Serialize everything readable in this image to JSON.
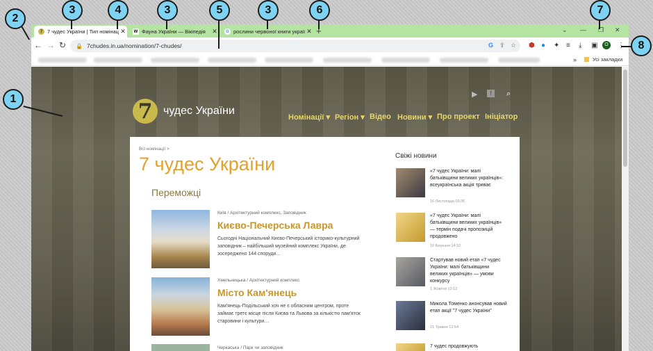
{
  "browser": {
    "tabs": [
      {
        "title": "7 чудес України | Тип номінації",
        "favicon": "7"
      },
      {
        "title": "Фауна України — Вікіпедія",
        "favicon": "W"
      },
      {
        "title": "рослини червоної книги україн",
        "favicon": "G"
      }
    ],
    "new_tab": "+",
    "url": "7chudes.in.ua/nomination/7-chudes/",
    "all_bookmarks": "Усі закладки",
    "more_bookmarks": "»",
    "profile_initial": "O"
  },
  "site": {
    "logo_num": "7",
    "logo_text": "чудес України",
    "menu": [
      "Номінації ▾",
      "Регіон ▾",
      "Відео",
      "Новини ▾",
      "Про проект",
      "Ініціатор"
    ],
    "breadcrumb": "Всі номінації >",
    "page_title": "7 чудес України",
    "section_title": "Переможці",
    "items": [
      {
        "category": "Київ / Архітектурний комплекс, Заповідник",
        "title": "Києво-Печерська Лавра",
        "desc": "Сьогодні Національний Києво-Печерський історико-культурний заповідник – найбільший музейний комплекс України, де зосереджено 144 споруди…"
      },
      {
        "category": "Хмельницька / Архітектурний комплекс",
        "title": "Місто Кам'янець",
        "desc": "Кам'янець-Подільський хоч не є обласним центром, проте займає третє місце після Києва та Львова за кількістю пам'яток старовини і культури…"
      },
      {
        "category": "Черкаська / Парк чи заповідник",
        "title": "",
        "desc": ""
      }
    ],
    "news_heading": "Свіжі новини",
    "news": [
      {
        "title": "«7 чудес України: малі батьківщини великих українців»: всеукраїнська акція триває",
        "date": "16 Листопада 09:36"
      },
      {
        "title": "«7 чудес України: малі батьківщини великих українців» — термін подачі пропозицій продовжено",
        "date": "10 Березня 14:32"
      },
      {
        "title": "Стартував новий етап «7 чудес України: малі батьківщини великих українців» — умови конкурсу",
        "date": "1 Жовтня 13:12"
      },
      {
        "title": "Микола Томенко анонсував новий етап акції \"7 чудес України\"",
        "date": "21 Травня 12:54"
      },
      {
        "title": "7 чудес продовжують",
        "date": ""
      }
    ]
  },
  "callouts": [
    "1",
    "2",
    "3",
    "4",
    "3",
    "5",
    "3",
    "6",
    "7",
    "8"
  ]
}
